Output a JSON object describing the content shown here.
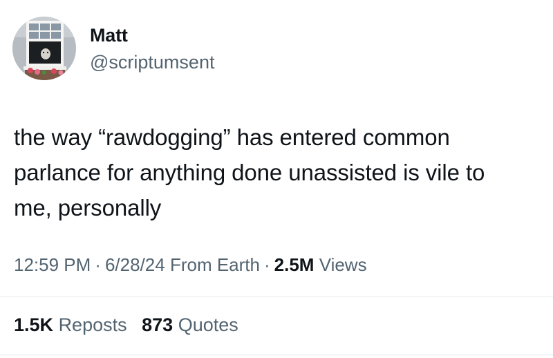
{
  "author": {
    "display_name": "Matt",
    "handle": "@scriptumsent",
    "avatar_icon": "profile-photo-window-with-dog"
  },
  "tweet": {
    "text": "the way “rawdogging” has entered common\nparlance for anything done unassisted is vile to\nme, personally"
  },
  "meta": {
    "time": "12:59 PM",
    "separator": "·",
    "date": "6/28/24",
    "source": "From Earth",
    "views_count": "2.5M",
    "views_label": "Views"
  },
  "stats": {
    "reposts_count": "1.5K",
    "reposts_label": "Reposts",
    "quotes_count": "873",
    "quotes_label": "Quotes"
  },
  "colors": {
    "text_primary": "#0f1419",
    "text_secondary": "#536471",
    "divider": "#e6e9ec",
    "background": "#ffffff"
  }
}
